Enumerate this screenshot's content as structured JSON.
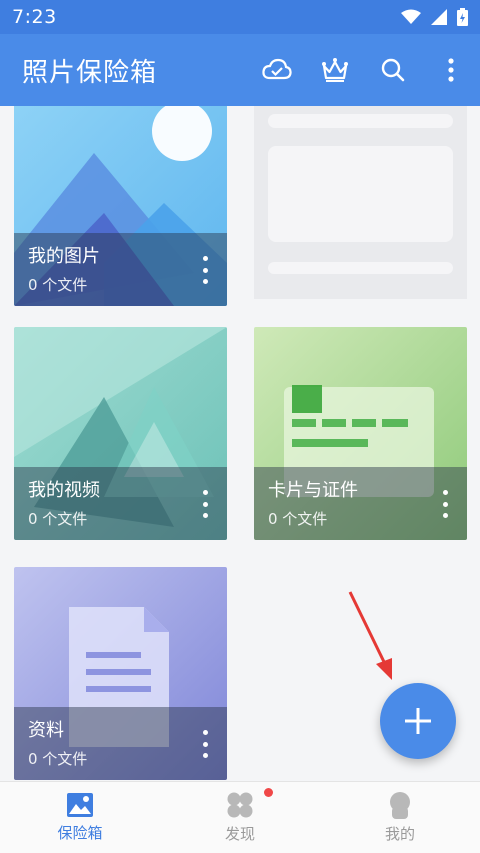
{
  "status_bar": {
    "time": "7:23"
  },
  "app_bar": {
    "title": "照片保险箱",
    "actions": [
      "cloud-icon",
      "crown-icon",
      "search-icon",
      "more-vert-icon"
    ]
  },
  "albums": [
    {
      "name": "我的图片",
      "count": "0 个文件",
      "icon": "image-icon"
    },
    {
      "name": "我的视频",
      "count": "0 个文件",
      "icon": "video-icon"
    },
    {
      "name": "卡片与证件",
      "count": "0 个文件",
      "icon": "card-icon"
    },
    {
      "name": "资料",
      "count": "0 个文件",
      "icon": "document-icon"
    }
  ],
  "fab": {
    "icon": "plus-icon"
  },
  "bottom_nav": {
    "items": [
      {
        "label": "保险箱",
        "icon": "image-icon",
        "active": true
      },
      {
        "label": "发现",
        "icon": "grid-icon",
        "badge": true
      },
      {
        "label": "我的",
        "icon": "avatar-icon"
      }
    ]
  },
  "colors": {
    "primary": "#4a8be8",
    "status_bar": "#3f7ee0",
    "badge": "#f04848"
  }
}
